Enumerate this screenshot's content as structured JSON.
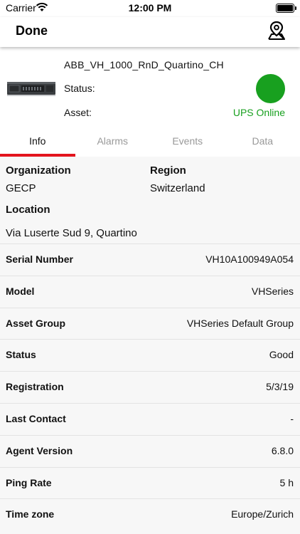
{
  "status_bar": {
    "carrier": "Carrier",
    "time": "12:00 PM"
  },
  "nav": {
    "done_label": "Done",
    "map_icon": "map-pin-icon"
  },
  "device": {
    "name": "ABB_VH_1000_RnD_Quartino_CH",
    "status_label": "Status:",
    "asset_label": "Asset:",
    "asset_value": "UPS Online",
    "status_color": "#18a01f"
  },
  "tabs": [
    {
      "label": "Info",
      "active": true
    },
    {
      "label": "Alarms",
      "active": false
    },
    {
      "label": "Events",
      "active": false
    },
    {
      "label": "Data",
      "active": false
    }
  ],
  "info": {
    "organization_label": "Organization",
    "organization_value": "GECP",
    "region_label": "Region",
    "region_value": "Switzerland",
    "location_label": "Location",
    "location_value": "Via Luserte Sud 9, Quartino",
    "rows": [
      {
        "key": "Serial Number",
        "value": "VH10A100949A054"
      },
      {
        "key": "Model",
        "value": "VHSeries"
      },
      {
        "key": "Asset Group",
        "value": "VHSeries Default Group"
      },
      {
        "key": "Status",
        "value": "Good"
      },
      {
        "key": "Registration",
        "value": "5/3/19"
      },
      {
        "key": "Last Contact",
        "value": "-"
      },
      {
        "key": "Agent Version",
        "value": "6.8.0"
      },
      {
        "key": "Ping Rate",
        "value": "5 h"
      },
      {
        "key": "Time zone",
        "value": "Europe/Zurich"
      }
    ]
  },
  "colors": {
    "accent_red": "#e3141e",
    "online_green": "#18a01f"
  }
}
